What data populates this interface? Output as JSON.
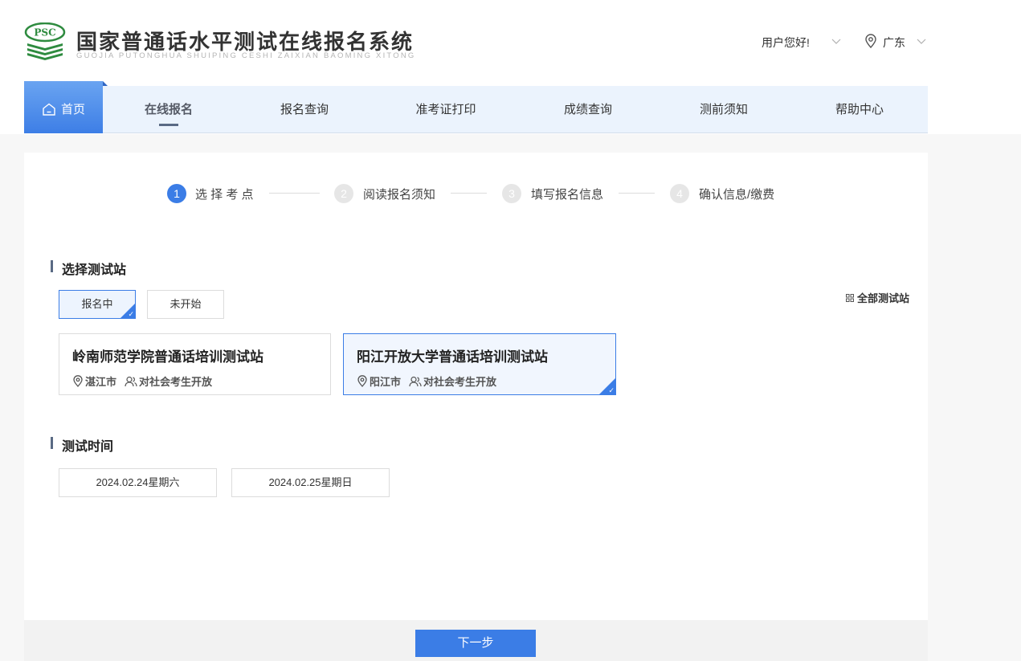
{
  "header": {
    "logo_badge": "PSC",
    "title": "国家普通话水平测试在线报名系统",
    "subtitle": "GUOJIA PUTONGHUA SHUIPING CESHI ZAIXIAN BAOMING XITONG",
    "user_greeting": "用户您好!",
    "region": "广东"
  },
  "nav": {
    "home": "首页",
    "items": [
      "在线报名",
      "报名查询",
      "准考证打印",
      "成绩查询",
      "测前须知",
      "帮助中心"
    ],
    "active_index": 0
  },
  "steps": [
    {
      "num": "1",
      "label": "选 择 考 点",
      "active": true
    },
    {
      "num": "2",
      "label": "阅读报名须知",
      "active": false
    },
    {
      "num": "3",
      "label": "填写报名信息",
      "active": false
    },
    {
      "num": "4",
      "label": "确认信息/缴费",
      "active": false
    }
  ],
  "station_section": {
    "title": "选择测试站",
    "filters": [
      {
        "label": "报名中",
        "selected": true
      },
      {
        "label": "未开始",
        "selected": false
      }
    ],
    "all_link": "全部测试站",
    "stations": [
      {
        "name": "岭南师范学院普通话培训测试站",
        "city": "湛江市",
        "access": "对社会考生开放",
        "selected": false
      },
      {
        "name": "阳江开放大学普通话培训测试站",
        "city": "阳江市",
        "access": "对社会考生开放",
        "selected": true
      }
    ]
  },
  "time_section": {
    "title": "测试时间",
    "dates": [
      "2024.02.24星期六",
      "2024.02.25星期日"
    ]
  },
  "footer": {
    "next_label": "下一步"
  },
  "colors": {
    "accent": "#3b7de6",
    "nav_bg": "#ebf3fd",
    "logo_green": "#2e8b3f"
  }
}
